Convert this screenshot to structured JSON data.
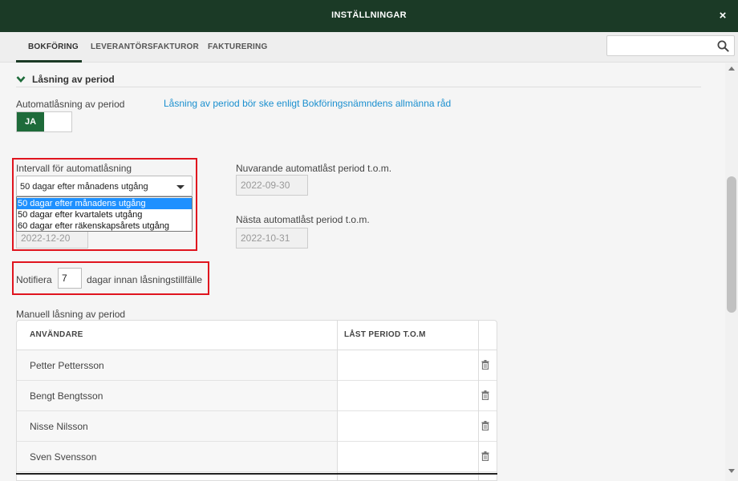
{
  "window": {
    "title": "INSTÄLLNINGAR",
    "close_glyph": "×"
  },
  "tabs": [
    {
      "label": "BOKFÖRING",
      "active": true
    },
    {
      "label": "LEVERANTÖRSFAKTUROR",
      "active": false
    },
    {
      "label": "FAKTURERING",
      "active": false
    }
  ],
  "search": {
    "value": "",
    "placeholder": "",
    "icon": "search-icon"
  },
  "section": {
    "title": "Låsning av period",
    "icon": "chevron-down-icon"
  },
  "auto_lock": {
    "label": "Automatlåsning av period",
    "toggle_label": "JA",
    "info_link": "Låsning av period bör ske enligt Bokföringsnämndens allmänna råd"
  },
  "interval": {
    "label": "Intervall för automatlåsning",
    "selected": "50 dagar efter månadens utgång",
    "options": [
      "50 dagar efter månadens utgång",
      "50 dagar efter kvartalets utgång",
      "60 dagar efter räkenskapsårets utgång"
    ],
    "hidden_field_value": "2022-12-20"
  },
  "current_period": {
    "label": "Nuvarande automatlåst period t.o.m.",
    "value": "2022-09-30"
  },
  "next_period": {
    "label": "Nästa automatlåst period t.o.m.",
    "value": "2022-10-31"
  },
  "notify": {
    "prefix": "Notifiera",
    "value": "7",
    "suffix": "dagar innan låsningstillfälle"
  },
  "manual": {
    "label": "Manuell låsning av period",
    "columns": [
      "ANVÄNDARE",
      "LÅST PERIOD T.O.M"
    ],
    "rows": [
      {
        "user": "Petter Pettersson",
        "period": ""
      },
      {
        "user": "Bengt Bengtsson",
        "period": ""
      },
      {
        "user": "Nisse Nilsson",
        "period": ""
      },
      {
        "user": "Sven Svensson",
        "period": ""
      }
    ]
  },
  "colors": {
    "header_bg": "#1b3a26",
    "toggle_on": "#1e6b3a",
    "link": "#1a8fcf",
    "highlight": "#e0141e"
  }
}
